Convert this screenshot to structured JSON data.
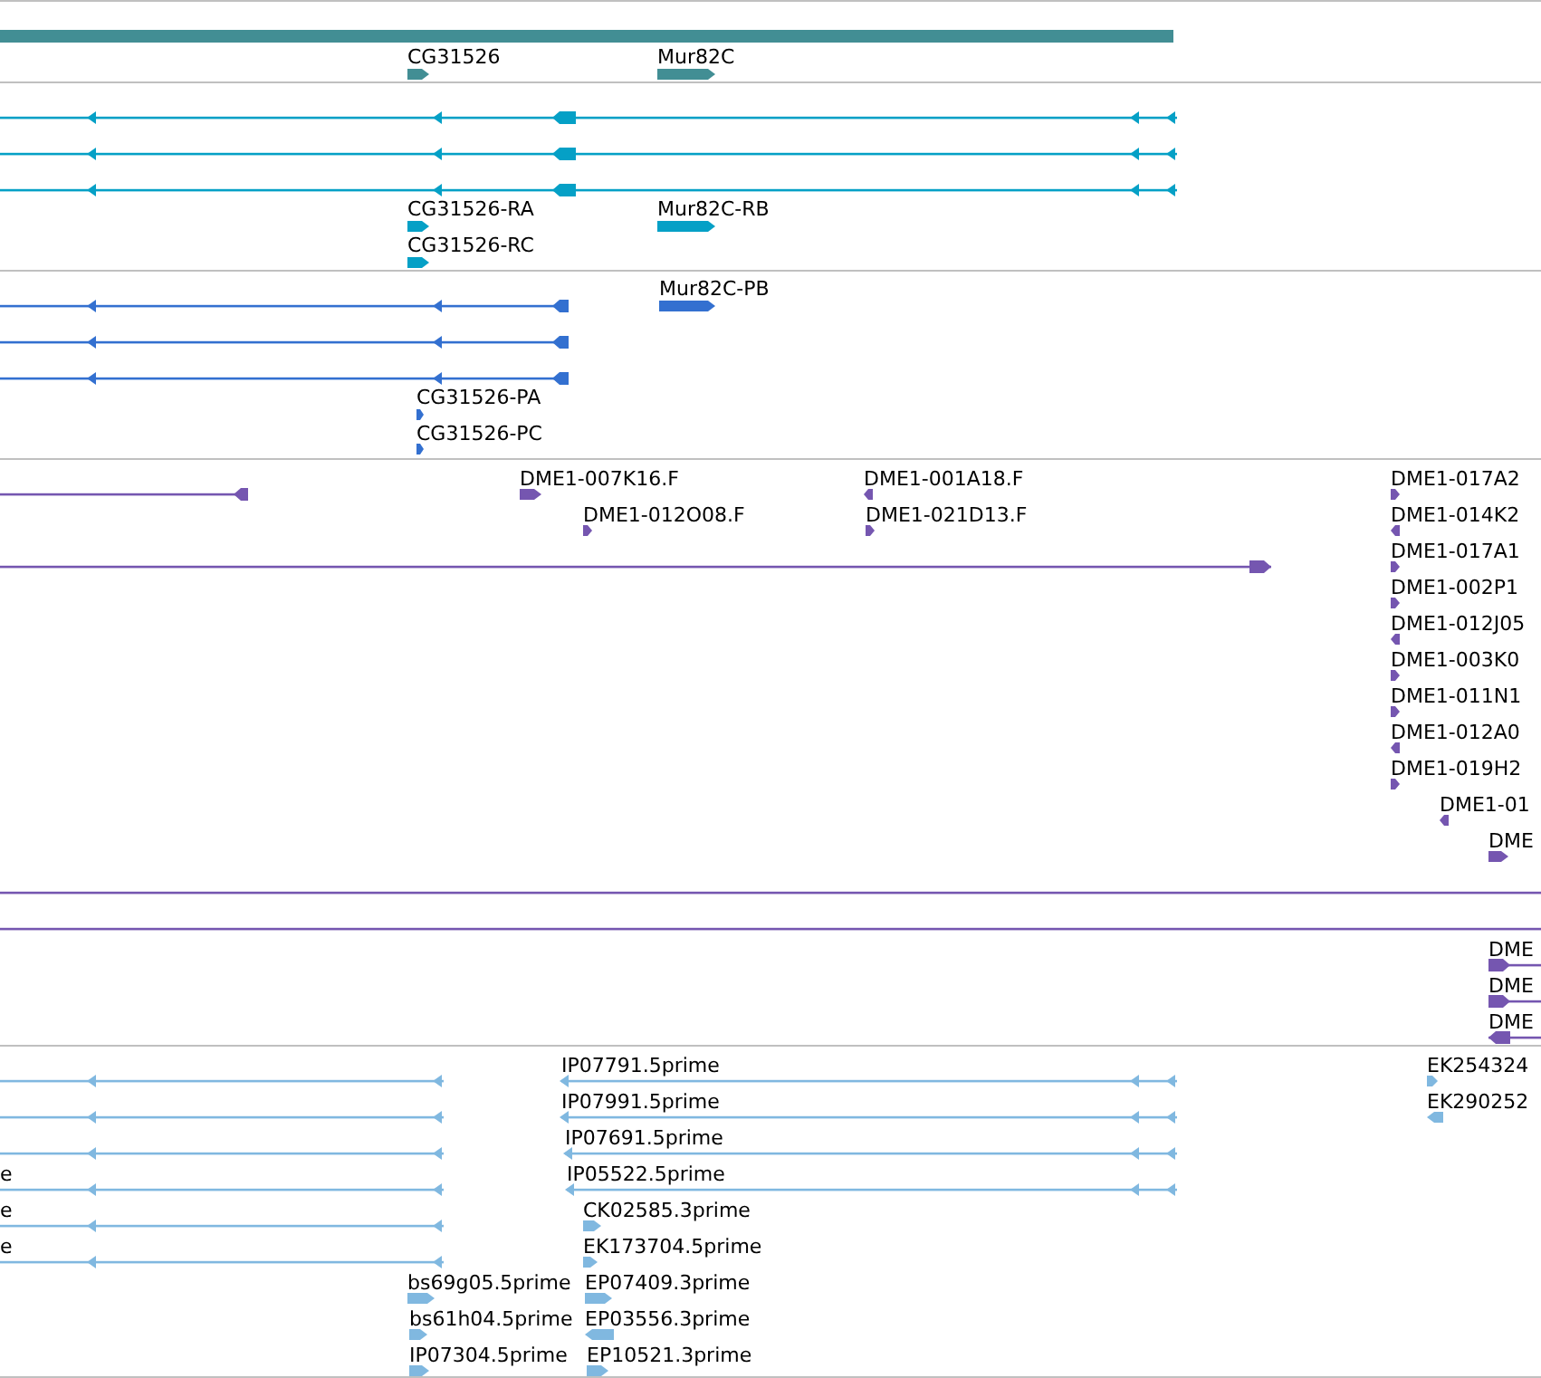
{
  "tracks": [
    {
      "color": "#428e94",
      "features": [
        {
          "kind": "bar"
        },
        {
          "kind": "glyph",
          "label": "CG31526",
          "reverse": false
        },
        {
          "kind": "glyph",
          "label": "Mur82C",
          "reverse": false
        }
      ]
    },
    {
      "color": "#05a0c6",
      "features": [
        {
          "kind": "line",
          "reverse": true
        },
        {
          "kind": "line",
          "reverse": true
        },
        {
          "kind": "line",
          "reverse": true
        },
        {
          "kind": "glyph",
          "label": "CG31526-RA",
          "reverse": false
        },
        {
          "kind": "glyph",
          "label": "CG31526-RC",
          "reverse": false
        },
        {
          "kind": "glyph",
          "label": "Mur82C-RB",
          "reverse": false
        }
      ]
    },
    {
      "color": "#3370d0",
      "features": [
        {
          "kind": "glyph",
          "label": "Mur82C-PB",
          "reverse": false
        },
        {
          "kind": "line",
          "reverse": true
        },
        {
          "kind": "line",
          "reverse": true
        },
        {
          "kind": "line",
          "reverse": true
        },
        {
          "kind": "glyph",
          "label": "CG31526-PA",
          "reverse": false
        },
        {
          "kind": "glyph",
          "label": "CG31526-PC",
          "reverse": false
        }
      ]
    },
    {
      "color": "#7556b0",
      "features": [
        {
          "kind": "line",
          "reverse": true
        },
        {
          "kind": "glyph",
          "label": "DME1-007K16.F",
          "reverse": false
        },
        {
          "kind": "glyph",
          "label": "DME1-012O08.F",
          "reverse": false
        },
        {
          "kind": "glyph",
          "label": "DME1-001A18.F",
          "reverse": true
        },
        {
          "kind": "glyph",
          "label": "DME1-021D13.F",
          "reverse": false
        },
        {
          "kind": "line",
          "reverse": false
        },
        {
          "kind": "glyph",
          "label": "DME1-017A2",
          "reverse": false
        },
        {
          "kind": "glyph",
          "label": "DME1-014K2",
          "reverse": true
        },
        {
          "kind": "glyph",
          "label": "DME1-017A1",
          "reverse": false
        },
        {
          "kind": "glyph",
          "label": "DME1-002P1",
          "reverse": false
        },
        {
          "kind": "glyph",
          "label": "DME1-012J05",
          "reverse": true
        },
        {
          "kind": "glyph",
          "label": "DME1-003K0",
          "reverse": false
        },
        {
          "kind": "glyph",
          "label": "DME1-011N1",
          "reverse": false
        },
        {
          "kind": "glyph",
          "label": "DME1-012A0",
          "reverse": true
        },
        {
          "kind": "glyph",
          "label": "DME1-019H2",
          "reverse": false
        },
        {
          "kind": "glyph",
          "label": "DME1-01",
          "reverse": true
        },
        {
          "kind": "glyph",
          "label": "DME",
          "reverse": false
        },
        {
          "kind": "line",
          "reverse": false
        },
        {
          "kind": "line",
          "reverse": false
        },
        {
          "kind": "line",
          "label": "DME",
          "reverse": false
        },
        {
          "kind": "line",
          "label": "DME",
          "reverse": false
        },
        {
          "kind": "line",
          "label": "DME",
          "reverse": true
        }
      ]
    },
    {
      "color": "#80b8e0",
      "features": [
        {
          "kind": "line",
          "reverse": true
        },
        {
          "kind": "line",
          "reverse": true
        },
        {
          "kind": "line",
          "reverse": true
        },
        {
          "kind": "line",
          "label": "e",
          "reverse": true
        },
        {
          "kind": "line",
          "label": "e",
          "reverse": true
        },
        {
          "kind": "line",
          "label": "e",
          "reverse": true
        },
        {
          "kind": "line",
          "label": "IP07791.5prime",
          "reverse": true
        },
        {
          "kind": "line",
          "label": "IP07991.5prime",
          "reverse": true
        },
        {
          "kind": "line",
          "label": "IP07691.5prime",
          "reverse": true
        },
        {
          "kind": "line",
          "label": "IP05522.5prime",
          "reverse": true
        },
        {
          "kind": "glyph",
          "label": "CK02585.3prime",
          "reverse": false
        },
        {
          "kind": "glyph",
          "label": "EK173704.5prime",
          "reverse": false
        },
        {
          "kind": "glyph",
          "label": "bs69g05.5prime",
          "reverse": false
        },
        {
          "kind": "glyph",
          "label": "EP07409.3prime",
          "reverse": false
        },
        {
          "kind": "glyph",
          "label": "bs61h04.5prime",
          "reverse": false
        },
        {
          "kind": "glyph",
          "label": "EP03556.3prime",
          "reverse": true
        },
        {
          "kind": "glyph",
          "label": "IP07304.5prime",
          "reverse": false
        },
        {
          "kind": "glyph",
          "label": "EP10521.3prime",
          "reverse": false
        },
        {
          "kind": "glyph",
          "label": "EK254324",
          "reverse": false
        },
        {
          "kind": "glyph",
          "label": "EK290252",
          "reverse": true
        }
      ]
    }
  ]
}
